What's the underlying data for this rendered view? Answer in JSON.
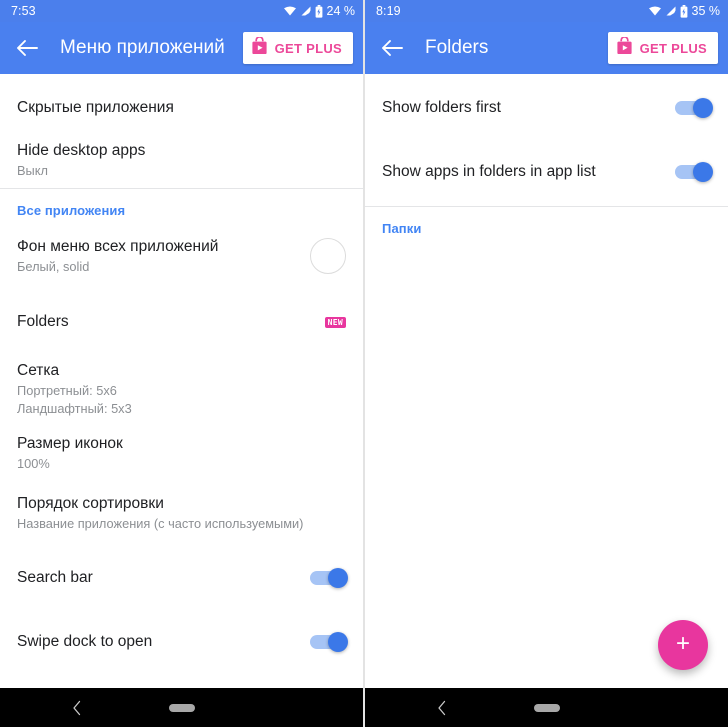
{
  "left": {
    "status": {
      "time": "7:53",
      "battery": "24 %",
      "icons": [
        "wifi-icon",
        "signal-icon",
        "battery-icon"
      ]
    },
    "appbar": {
      "title": "Меню приложений",
      "back": "back-arrow-icon",
      "get_plus": "GET PLUS",
      "plus_icon": "play-store-bag-icon"
    },
    "rows": [
      {
        "title": "Скрытые приложения",
        "sub": null,
        "control": "none",
        "name": "hidden-apps"
      },
      {
        "title": "Hide desktop apps",
        "sub": "Выкл",
        "control": "none",
        "name": "hide-desktop-apps"
      },
      {
        "title": "Фон меню всех приложений",
        "sub": "Белый, solid",
        "control": "swatch",
        "name": "all-apps-background"
      },
      {
        "title": "Folders",
        "sub": null,
        "control": "new-badge",
        "badge": "NEW",
        "name": "folders"
      },
      {
        "title": "Сетка",
        "sub": "Портретный: 5x6",
        "sub2": "Ландшафтный: 5x3",
        "control": "none",
        "name": "grid"
      },
      {
        "title": "Размер иконок",
        "sub": "100%",
        "control": "none",
        "name": "icon-size"
      },
      {
        "title": "Порядок сортировки",
        "sub": "Название приложения (с часто используемыми)",
        "control": "none",
        "name": "sort-order"
      },
      {
        "title": "Search bar",
        "sub": null,
        "control": "toggle",
        "toggle_on": true,
        "name": "search-bar"
      },
      {
        "title": "Swipe dock to open",
        "sub": null,
        "control": "toggle",
        "toggle_on": true,
        "name": "swipe-dock-to-open"
      }
    ],
    "section_header": "Все приложения"
  },
  "right": {
    "status": {
      "time": "8:19",
      "battery": "35 %",
      "icons": [
        "wifi-icon",
        "signal-icon",
        "battery-icon"
      ]
    },
    "appbar": {
      "title": "Folders",
      "back": "back-arrow-icon",
      "get_plus": "GET PLUS",
      "plus_icon": "play-store-bag-icon"
    },
    "rows": [
      {
        "title": "Show folders first",
        "control": "toggle",
        "toggle_on": true,
        "name": "show-folders-first"
      },
      {
        "title": "Show apps in folders in app list",
        "control": "toggle",
        "toggle_on": true,
        "name": "show-apps-in-folders"
      }
    ],
    "section_header": "Папки",
    "fab": {
      "icon": "plus-icon",
      "label": "+"
    }
  },
  "colors": {
    "appbar_blue": "#4a80ef",
    "statusbar_blue": "#4b7fec",
    "accent_pink": "#e8369e",
    "get_plus_pink": "#ec4899",
    "toggle_on": "#3b78e8",
    "toggle_track": "#a6c4f5",
    "section_blue": "#4285f4",
    "title_text": "#202124",
    "sub_text": "#8c8f93",
    "divider": "#e4e5e7",
    "navbar": "#000000"
  },
  "navbar": {
    "back": "nav-back-chevron-icon",
    "home": "nav-home-pill"
  }
}
